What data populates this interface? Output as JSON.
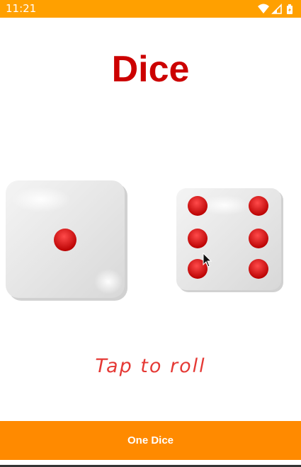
{
  "status_bar": {
    "time": "11:21",
    "icons": [
      "wifi-icon",
      "signal-icon",
      "battery-icon"
    ],
    "color": "#FFA000"
  },
  "app": {
    "title": "Dice",
    "title_color": "#CC0000"
  },
  "dice": [
    {
      "name": "die-left",
      "value": 1
    },
    {
      "name": "die-right",
      "value": 6
    }
  ],
  "tap_hint": "Tap to roll",
  "bottom_button": {
    "label": "One Dice",
    "color": "#FF8A00"
  }
}
